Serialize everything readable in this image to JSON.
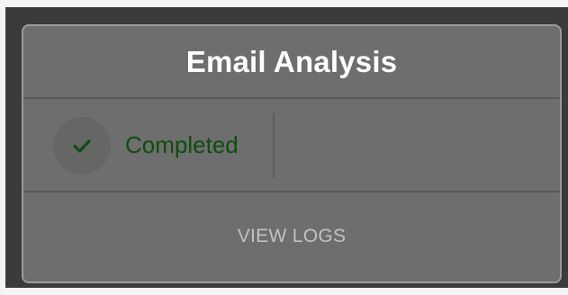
{
  "card": {
    "title": "Email Analysis",
    "status": {
      "label": "Completed",
      "icon": "checkmark-icon",
      "color": "#0e4d0e"
    },
    "action_label": "VIEW LOGS"
  },
  "colors": {
    "card_background": "#6e6e6e",
    "card_border": "#9a9a9a",
    "backdrop": "#3b3b3b",
    "status_green": "#0e4d0e"
  }
}
